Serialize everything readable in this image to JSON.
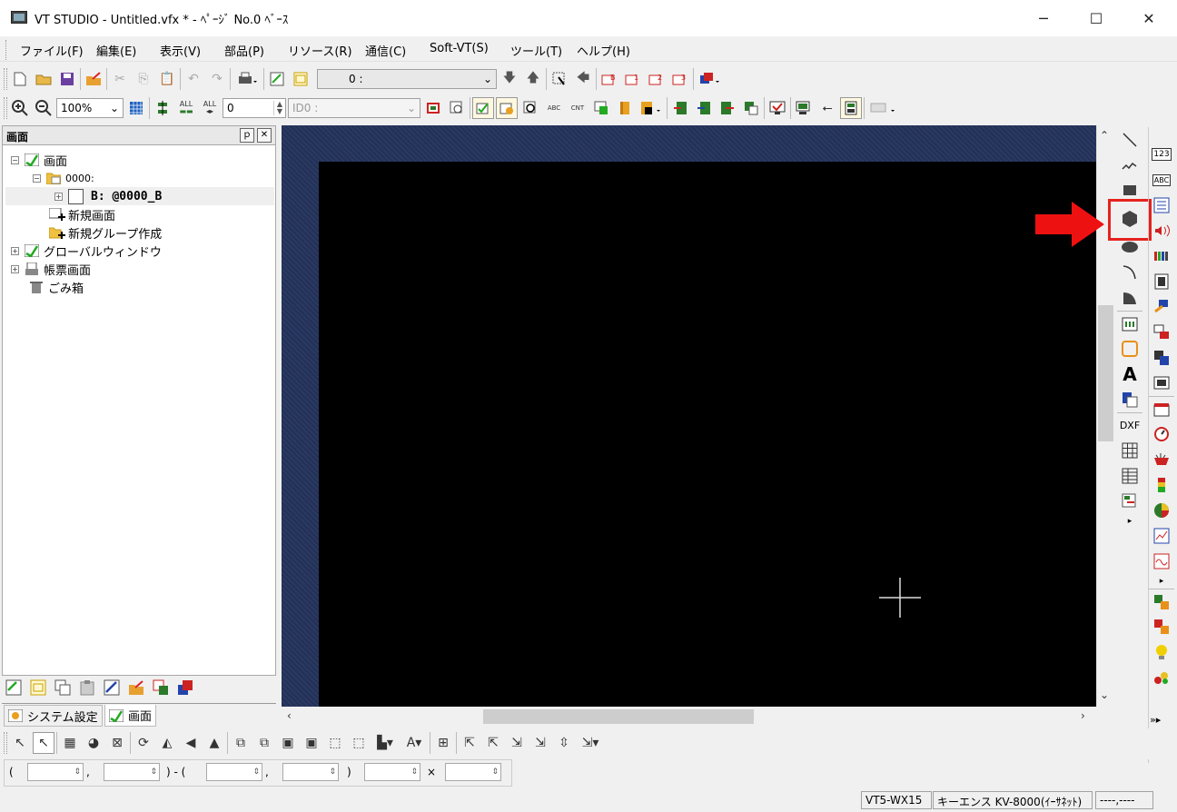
{
  "window": {
    "title": "VT STUDIO - Untitled.vfx * - ﾍﾟｰｼﾞ No.0 ﾍﾞｰｽ",
    "minimize": "─",
    "maximize": "☐",
    "close": "✕"
  },
  "menu": [
    "ファイル(F)",
    "編集(E)",
    "表示(V)",
    "部品(P)",
    "リソース(R)",
    "通信(C)",
    "Soft-VT(S)",
    "ツール(T)",
    "ヘルプ(H)"
  ],
  "toolbar1": {
    "page_combo_value": "0 :"
  },
  "toolbar2": {
    "zoom_value": "100%",
    "alt1": "ALL",
    "alt2": "ALL",
    "id_spin_value": "0",
    "id_combo_value": "ID0 :"
  },
  "panel": {
    "title": "画面",
    "pin": "ｐ",
    "close": "✕"
  },
  "tree": {
    "root": "画面",
    "group": "0000:",
    "screen": "B: @0000_B",
    "new_screen": "新規画面",
    "new_group": "新規グループ作成",
    "global_window": "グローバルウィンドウ",
    "report": "帳票画面",
    "trash": "ごみ箱"
  },
  "tabs": {
    "system": "システム設定",
    "screen": "画面"
  },
  "shape_panel": {
    "text_tool": "A",
    "dxf": "DXF",
    "more": "▸"
  },
  "obj_panel": {
    "num": "123",
    "abc": "ABC",
    "more": "▸",
    "expand": "»▸"
  },
  "coords": {
    "open": "(",
    "comma1": ",",
    "mid": ") - (",
    "comma2": ",",
    "close": ")",
    "times": "×"
  },
  "status": {
    "model": "VT5-WX15",
    "plc": "キーエンス KV-8000(ｲｰｻﾈｯﾄ)",
    "pos": "----,----"
  },
  "colors": {
    "highlight_box": "#e5221e",
    "arrow": "#ee1111",
    "canvas_bg": "#000000",
    "frame": "#2b3a63"
  }
}
